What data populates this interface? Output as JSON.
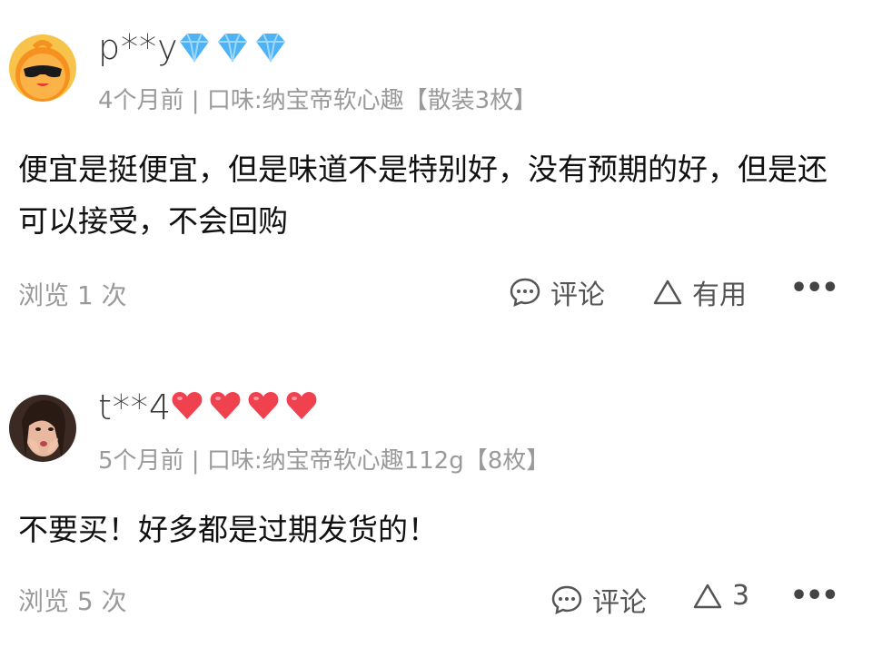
{
  "reviews": [
    {
      "username": "p**y",
      "badge_type": "diamond",
      "badge_count": 3,
      "badge_color": "#4db3f5",
      "meta": "4个月前 | 口味:纳宝帝软心趣【散装3枚】",
      "text": "便宜是挺便宜，但是味道不是特别好，没有预期的好，但是还可以接受，不会回购",
      "views": "浏览 1 次",
      "comment_label": "评论",
      "useful_label": "有用",
      "more_label": "•••"
    },
    {
      "username": "t**4",
      "badge_type": "heart",
      "badge_count": 4,
      "badge_color": "#f0414f",
      "meta": "5个月前 | 口味:纳宝帝软心趣112g【8枚】",
      "text": "不要买！好多都是过期发货的！",
      "views": "浏览 5 次",
      "comment_label": "评论",
      "useful_label": "3",
      "more_label": "•••"
    }
  ]
}
